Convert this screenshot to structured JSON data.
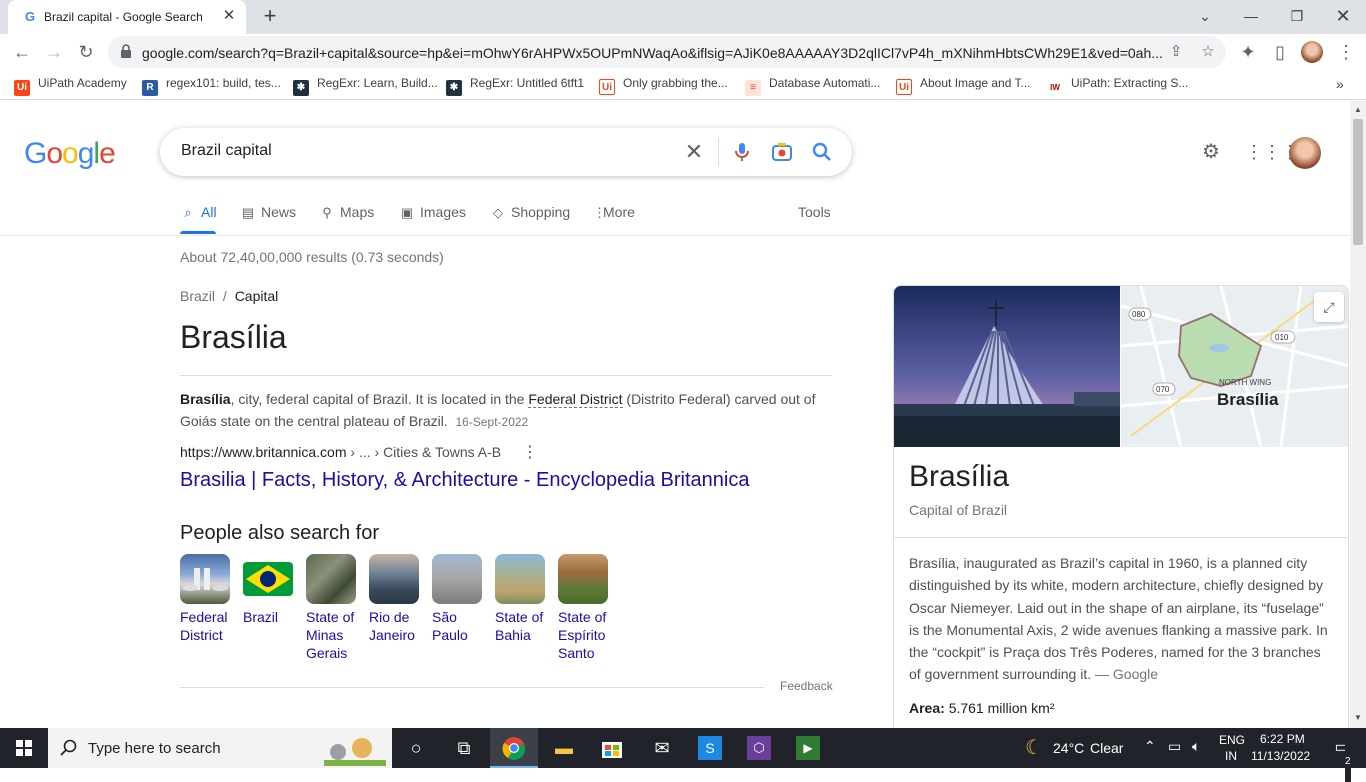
{
  "browser": {
    "tab_title": "Brazil capital - Google Search",
    "tab_favicon": "G",
    "url": "google.com/search?q=Brazil+capital&source=hp&ei=mOhwY6rAHPWx5OUPmNWaqAo&iflsig=AJiK0e8AAAAAY3D2qlICl7vP4h_mXNihmHbtsCWh29E1&ved=0ah..."
  },
  "bookmarks": [
    {
      "label": "UiPath Academy",
      "icon": "Ui",
      "color": "#fa4616"
    },
    {
      "label": "regex101: build, tes...",
      "icon": "R",
      "color": "#2d5aa0"
    },
    {
      "label": "RegExr: Learn, Build...",
      "icon": "✱",
      "color": "#22313f"
    },
    {
      "label": "RegExr: Untitled 6tft1",
      "icon": "✱",
      "color": "#22313f"
    },
    {
      "label": "Only grabbing the...",
      "icon": "Ui",
      "color": "#fa4616"
    },
    {
      "label": "Database Automati...",
      "icon": "≡",
      "color": "#e44d26"
    },
    {
      "label": "About Image and T...",
      "icon": "Ui",
      "color": "#fa4616"
    },
    {
      "label": "UiPath: Extracting S...",
      "icon": "IW",
      "color": "#c00000"
    }
  ],
  "search": {
    "query": "Brazil capital",
    "tabs": [
      {
        "label": "All",
        "icon": "search-icon"
      },
      {
        "label": "News",
        "icon": "news-icon"
      },
      {
        "label": "Maps",
        "icon": "map-pin-icon"
      },
      {
        "label": "Images",
        "icon": "image-icon"
      },
      {
        "label": "Shopping",
        "icon": "tag-icon"
      },
      {
        "label": "More",
        "icon": "more-icon"
      }
    ],
    "tools_label": "Tools",
    "result_stats": "About 72,40,00,000 results (0.73 seconds)"
  },
  "answer": {
    "crumb_parent": "Brazil",
    "crumb_sep": "/",
    "crumb_current": "Capital",
    "title": "Brasília",
    "snippet_bold": "Brasília",
    "snippet_part1": ", city, federal capital of Brazil. It is located in the ",
    "snippet_link": "Federal District",
    "snippet_part2": " (Distrito Federal) carved out of Goiás state on the central plateau of Brazil.",
    "snippet_date": "16-Sept-2022",
    "cite_domain": "https://www.britannica.com",
    "cite_path": " › ... › Cities & Towns A-B",
    "result_title": "Brasilia | Facts, History, & Architecture - Encyclopedia Britannica"
  },
  "pasf": {
    "title": "People also search for",
    "items": [
      {
        "label": "Federal District"
      },
      {
        "label": "Brazil"
      },
      {
        "label": "State of Minas Gerais"
      },
      {
        "label": "Rio de Janeiro"
      },
      {
        "label": "São Paulo"
      },
      {
        "label": "State of Bahia"
      },
      {
        "label": "State of Espírito Santo"
      }
    ],
    "feedback": "Feedback"
  },
  "knowledge_panel": {
    "title": "Brasília",
    "subtitle": "Capital of Brazil",
    "map_label_area": "NORTH WING",
    "map_label_city": "Brasília",
    "map_road_1": "080",
    "map_road_2": "010",
    "map_road_3": "070",
    "description": "Brasília, inaugurated as Brazil’s capital in 1960, is a planned city distinguished by its white, modern architecture, chiefly designed by Oscar Niemeyer. Laid out in the shape of an airplane, its “fuselage” is the Monumental Axis, 2 wide avenues flanking a massive park. In the “cockpit” is Praça dos Três Poderes, named for the 3 branches of government surrounding it.",
    "description_source": "— Google",
    "area_label": "Area:",
    "area_value": "5.761 million km²"
  },
  "taskbar": {
    "search_placeholder": "Type here to search",
    "weather_temp": "24°C",
    "weather_desc": "Clear",
    "lang_top": "ENG",
    "lang_bottom": "IN",
    "time": "6:22 PM",
    "date": "11/13/2022",
    "notification_count": "2"
  },
  "colors": {
    "google_blue": "#4285f4",
    "google_red": "#ea4335",
    "google_yellow": "#fbbc05",
    "google_green": "#34a853",
    "link": "#1a0dab",
    "accent": "#1a73e8"
  }
}
